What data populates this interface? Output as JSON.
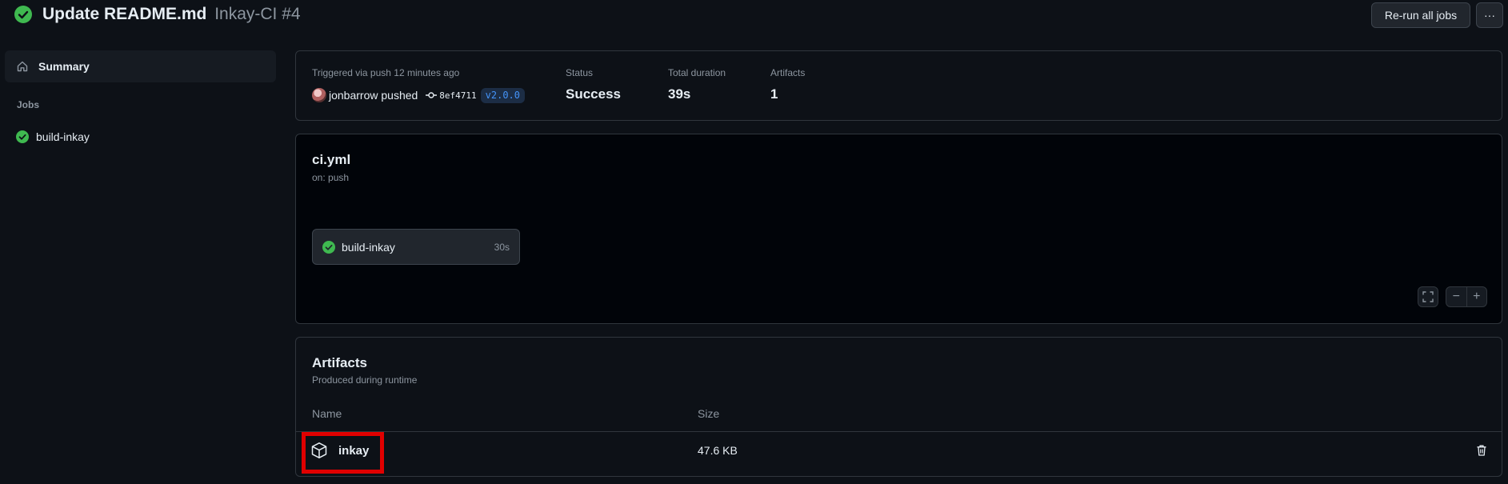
{
  "header": {
    "title": "Update README.md",
    "workflow_run": "Inkay-CI #4",
    "rerun_label": "Re-run all jobs",
    "more_label": "···",
    "status_icon": "check-circle-fill-icon"
  },
  "sidebar": {
    "summary_label": "Summary",
    "summary_icon": "home-icon",
    "jobs_heading": "Jobs",
    "jobs": [
      {
        "label": "build-inkay",
        "status": "success"
      }
    ]
  },
  "summary": {
    "trigger_label": "Triggered via push 12 minutes ago",
    "actor": "jonbarrow pushed",
    "commit_sha": "8ef4711",
    "ref_tag": "v2.0.0",
    "status_label": "Status",
    "status_value": "Success",
    "duration_label": "Total duration",
    "duration_value": "39s",
    "artifacts_label": "Artifacts",
    "artifacts_value": "1"
  },
  "workflow_graph": {
    "file": "ci.yml",
    "trigger": "on: push",
    "jobs": [
      {
        "label": "build-inkay",
        "duration": "30s",
        "status": "success"
      }
    ],
    "controls": {
      "zoom_out": "−",
      "zoom_in": "+"
    }
  },
  "artifacts": {
    "title": "Artifacts",
    "subtitle": "Produced during runtime",
    "columns": {
      "name": "Name",
      "size": "Size"
    },
    "rows": [
      {
        "name": "inkay",
        "size": "47.6 KB",
        "icon": "package-icon"
      }
    ]
  },
  "colors": {
    "success": "#3fb950",
    "background": "#0d1117",
    "highlight": "#e00000",
    "tag_text": "#4493f8"
  }
}
